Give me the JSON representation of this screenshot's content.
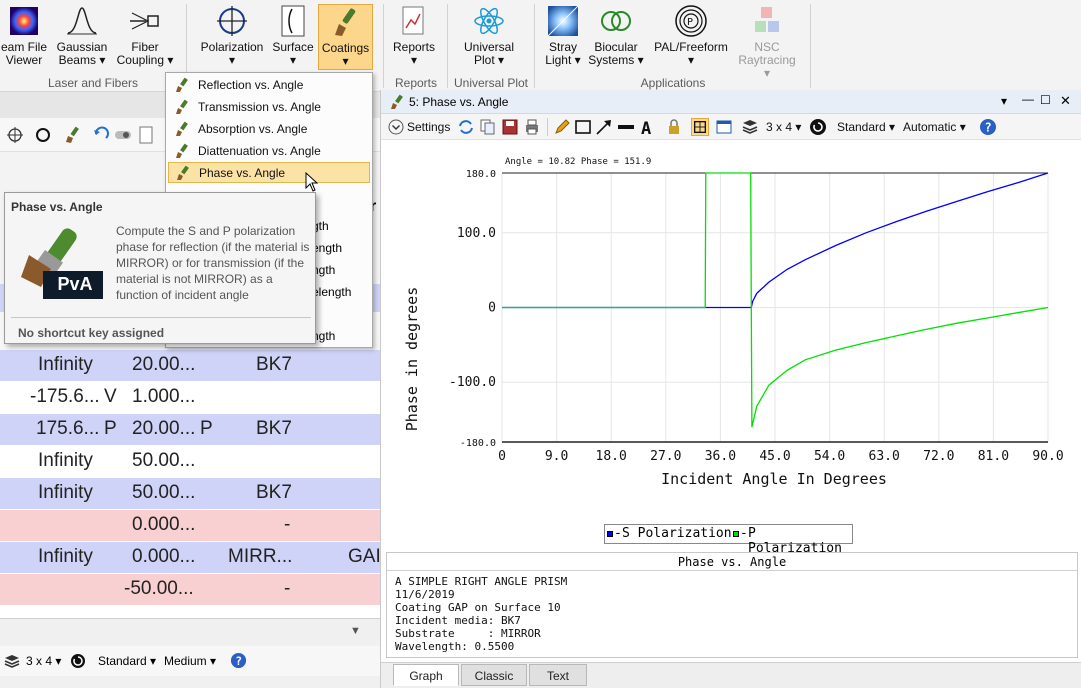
{
  "ribbon": {
    "buttons": [
      {
        "label1": "eam File",
        "label2": "Viewer"
      },
      {
        "label1": "Gaussian",
        "label2": "Beams",
        "caret": "▾"
      },
      {
        "label1": "Fiber",
        "label2": "Coupling",
        "caret": "▾"
      },
      {
        "label1": "Polarization",
        "caret": "▾"
      },
      {
        "label1": "Surface",
        "caret": "▾"
      },
      {
        "label1": "Coatings",
        "caret": "▾"
      },
      {
        "label1": "Reports",
        "caret": "▾"
      },
      {
        "label1": "Universal",
        "label2": "Plot",
        "caret": "▾"
      },
      {
        "label1": "Stray",
        "label2": "Light",
        "caret": "▾"
      },
      {
        "label1": "Biocular",
        "label2": "Systems",
        "caret": "▾"
      },
      {
        "label1": "PAL/Freeform",
        "caret": "▾"
      },
      {
        "label1": "NSC",
        "label2": "Raytracing",
        "caret": "▾"
      }
    ],
    "groups": [
      "Laser and Fibers",
      "Reports",
      "Universal Plot",
      "Applications"
    ]
  },
  "coatings_menu": {
    "items": [
      "Reflection vs. Angle",
      "Transmission vs. Angle",
      "Absorption vs. Angle",
      "Diattenuation vs. Angle",
      "Phase vs. Angle"
    ],
    "partial_items": [
      "gth",
      "ength",
      "ngth",
      "elength",
      "ngth"
    ]
  },
  "tooltip": {
    "title": "Phase vs. Angle",
    "description": "Compute the S and P polarization phase for reflection (if the material is MIRROR) or for transmission (if the material is not MIRROR) as a function of incident angle",
    "icon_text": "PvA",
    "footer": "No shortcut key assigned"
  },
  "lens_data": {
    "rows": [
      {
        "style": "blue",
        "c1": "Infinity",
        "c2": "",
        "c3": "20.00...",
        "c4": "",
        "c5": "BK7",
        "c6": ""
      },
      {
        "style": "white",
        "c1": "-175.6...",
        "c2": "V",
        "c3": "1.000...",
        "c4": "",
        "c5": "",
        "c6": ""
      },
      {
        "style": "blue",
        "c1": "175.6...",
        "c2": "P",
        "c3": "20.00...",
        "c4": "P",
        "c5": "BK7",
        "c6": ""
      },
      {
        "style": "white",
        "c1": "Infinity",
        "c2": "",
        "c3": "50.00...",
        "c4": "",
        "c5": "",
        "c6": ""
      },
      {
        "style": "blue",
        "c1": "Infinity",
        "c2": "",
        "c3": "50.00...",
        "c4": "",
        "c5": "BK7",
        "c6": ""
      },
      {
        "style": "pink",
        "c1": "",
        "c2": "",
        "c3": "0.000...",
        "c4": "",
        "c5": "-",
        "c6": ""
      },
      {
        "style": "blue",
        "c1": "Infinity",
        "c2": "",
        "c3": "0.000...",
        "c4": "",
        "c5": "MIRR...",
        "c6": "GAI"
      },
      {
        "style": "pink",
        "c1": "",
        "c2": "",
        "c3": "-50.00...",
        "c4": "",
        "c5": "-",
        "c6": ""
      }
    ],
    "header_partial": "r"
  },
  "left_bottom_toolbar": {
    "layout": "3 x 4",
    "caret": "▾",
    "style": "Standard",
    "quality": "Medium"
  },
  "analysis_window": {
    "title": "5: Phase vs. Angle",
    "toolbar": {
      "settings": "Settings",
      "layout": "3 x 4",
      "style": "Standard",
      "scale": "Automatic",
      "caret": "▾"
    },
    "window_controls": [
      "▾",
      "—",
      "☐",
      "✕"
    ],
    "text_panel": {
      "title": "Phase vs. Angle",
      "lines": [
        "A SIMPLE RIGHT ANGLE PRISM",
        "11/6/2019",
        "Coating GAP on Surface 10",
        "Incident media: BK7",
        "Substrate     : MIRROR",
        "Wavelength: 0.5500"
      ]
    },
    "tabs": [
      "Graph",
      "Classic",
      "Text"
    ],
    "active_tab": "Graph"
  },
  "chart_data": {
    "type": "line",
    "cursor_readout": "Angle = 10.82  Phase = 151.9",
    "xlabel": "Incident Angle In Degrees",
    "ylabel": "Phase in degrees",
    "xlim": [
      0,
      90
    ],
    "ylim": [
      -180,
      180
    ],
    "xticks": [
      "0",
      "9.0",
      "18.0",
      "27.0",
      "36.0",
      "45.0",
      "54.0",
      "63.0",
      "72.0",
      "81.0",
      "90.0"
    ],
    "yticks": [
      "180.0",
      "100.0",
      "0",
      "-100.0",
      "-180.0"
    ],
    "grid": true,
    "legend_position": "bottom",
    "series": [
      {
        "name": "S Polarization",
        "color": "#0000ff",
        "x": [
          0,
          33.5,
          41.1,
          41.3,
          42,
          44,
          47,
          50,
          55,
          60,
          65,
          70,
          75,
          80,
          85,
          90
        ],
        "y": [
          0,
          0,
          0,
          8,
          19,
          34,
          51,
          64,
          83,
          100,
          115,
          129,
          142,
          155,
          167,
          180
        ]
      },
      {
        "name": "P Polarization",
        "color": "#00e000",
        "x": [
          0,
          33.5,
          33.6,
          41.0,
          41.1,
          41.2,
          42,
          44,
          47,
          50,
          55,
          60,
          65,
          70,
          75,
          80,
          85,
          90
        ],
        "y": [
          0,
          0,
          180,
          180,
          0,
          -160,
          -132,
          -104,
          -84,
          -70,
          -57,
          -47,
          -38,
          -29,
          -21,
          -14,
          -7,
          0
        ]
      }
    ]
  }
}
